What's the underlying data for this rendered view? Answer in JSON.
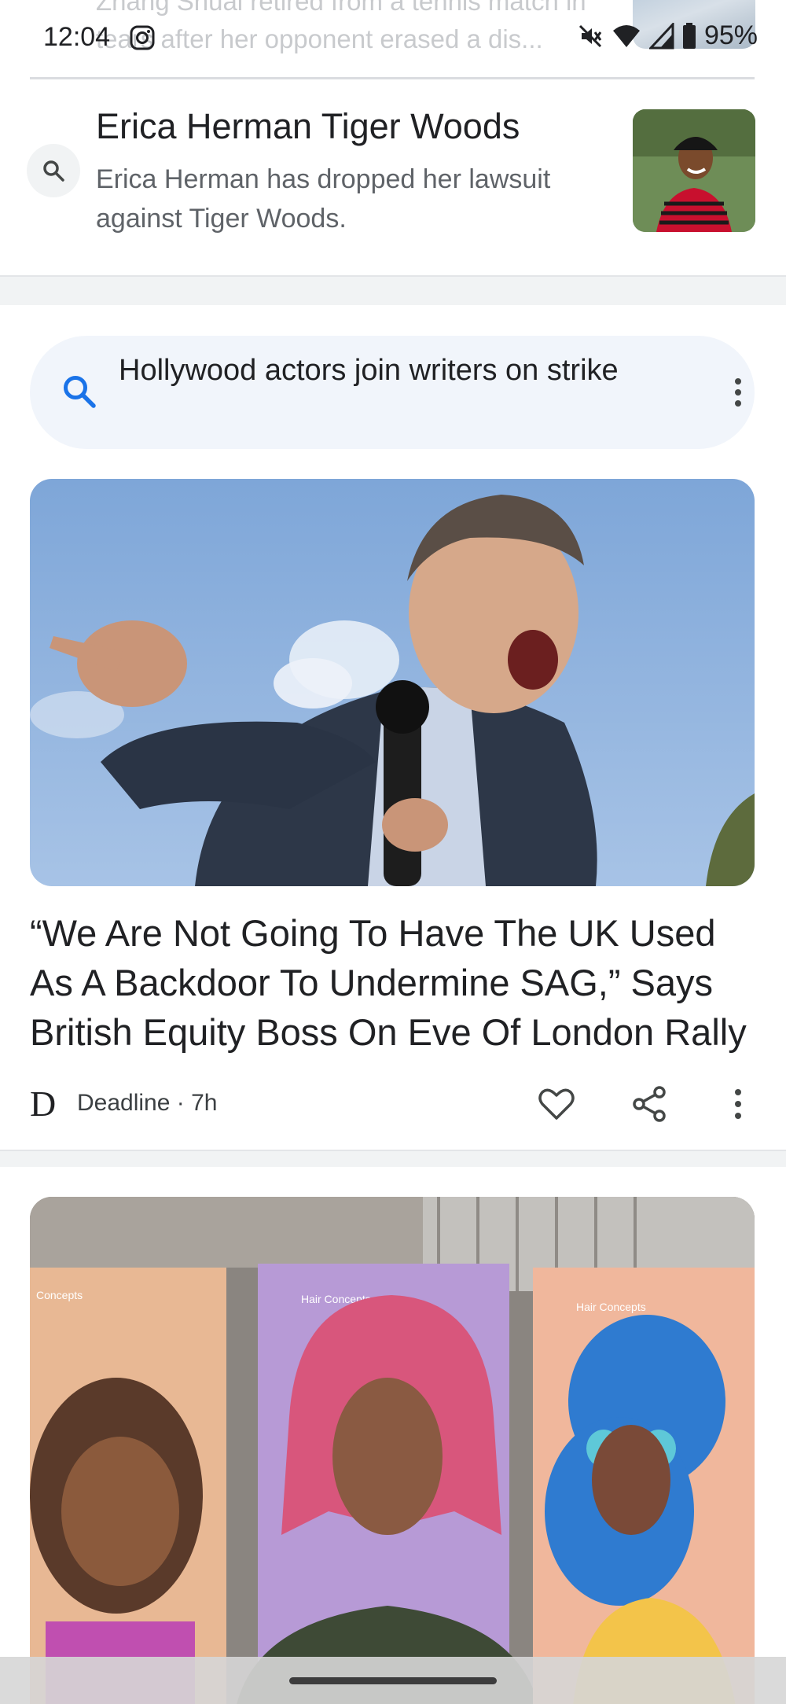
{
  "status_bar": {
    "time": "12:04",
    "battery": "95%",
    "icons": [
      "instagram-icon",
      "mute-icon",
      "wifi-icon",
      "signal-icon",
      "battery-icon"
    ]
  },
  "previous_item": {
    "text": "Zhang Shuai retired from a tennis match in tears after her opponent erased a dis..."
  },
  "related_search": {
    "title": "Erica Herman Tiger Woods",
    "description": "Erica Herman has dropped her lawsuit against Tiger Woods.",
    "icon": "search-icon"
  },
  "search_chip": {
    "text": "Hollywood actors join writers on strike",
    "icon": "search-icon",
    "accent": "#1a73e8"
  },
  "article": {
    "title": "“We Are Not Going To Have The UK Used As A Backdoor To Undermine SAG,” Says British Equity Boss On Eve Of London Rally",
    "source_logo": "D",
    "source": "Deadline",
    "age": "7h",
    "meta": "Deadline · 7h"
  },
  "next_article": {
    "panel_labels": [
      "Concepts",
      "Hair Concepts",
      "Hair Concepts"
    ]
  },
  "colors": {
    "text_primary": "#202124",
    "text_secondary": "#5f6368",
    "chip_bg": "#f1f5fb",
    "divider": "#f1f3f4"
  }
}
